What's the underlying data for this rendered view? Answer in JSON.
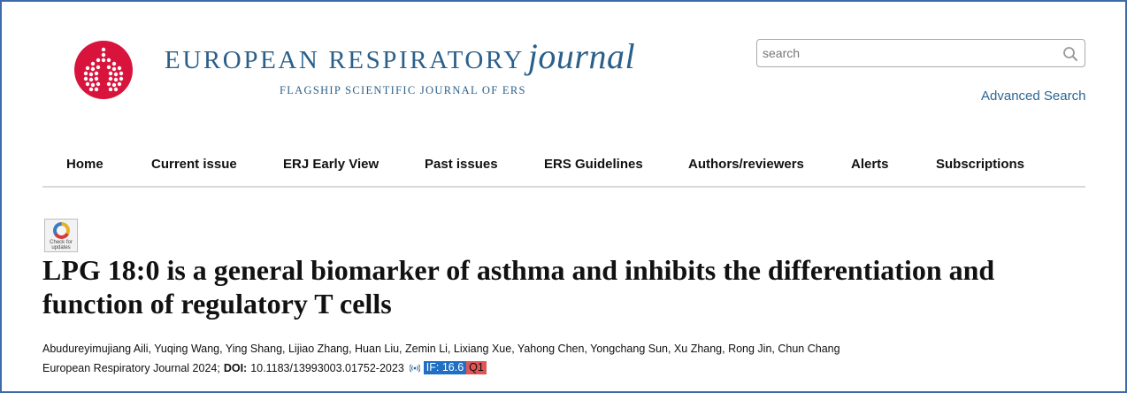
{
  "header": {
    "brand_caps": "EUROPEAN RESPIRATORY",
    "brand_journal": "journal",
    "brand_subtitle": "FLAGSHIP SCIENTIFIC JOURNAL OF ERS",
    "logo_color": "#d8143c",
    "brand_color": "#2b5f8a"
  },
  "search": {
    "placeholder": "search",
    "value": "",
    "advanced_label": "Advanced Search"
  },
  "nav": {
    "items": [
      {
        "label": "Home"
      },
      {
        "label": "Current issue"
      },
      {
        "label": "ERJ Early View"
      },
      {
        "label": "Past issues"
      },
      {
        "label": "ERS Guidelines"
      },
      {
        "label": "Authors/reviewers"
      },
      {
        "label": "Alerts"
      },
      {
        "label": "Subscriptions"
      }
    ]
  },
  "article": {
    "check_updates": "Check for updates",
    "title": "LPG 18:0 is a general biomarker of asthma and inhibits the differentiation and function of regulatory T cells",
    "authors": "Abudureyimujiang Aili, Yuqing Wang, Ying Shang, Lijiao Zhang, Huan Liu, Zemin Li, Lixiang Xue, Yahong Chen, Yongchang Sun, Xu Zhang, Rong Jin, Chun Chang",
    "journal_year": "European Respiratory Journal 2024;",
    "doi_label": "DOI:",
    "doi_value": "10.1183/13993003.01752-2023",
    "impact_factor": "IF: 16.6",
    "quartile": "Q1",
    "if_color": "#1f6fc4",
    "q_color": "#e05555"
  }
}
